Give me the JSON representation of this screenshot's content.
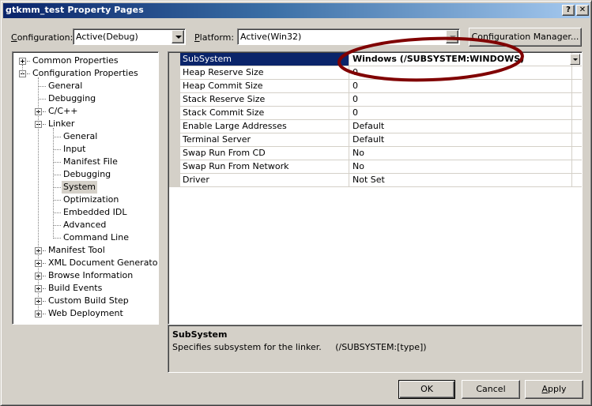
{
  "window": {
    "title": "gtkmm_test Property Pages",
    "help_button": "?",
    "close_button": "✕"
  },
  "toolbar": {
    "configuration_label_prefix": "C",
    "configuration_label_rest": "onfiguration:",
    "configuration_value": "Active(Debug)",
    "platform_label_prefix": "P",
    "platform_label_rest": "latform:",
    "platform_value": "Active(Win32)",
    "config_manager_label": "Configuration Manager..."
  },
  "tree": {
    "items": [
      {
        "label": "Common Properties",
        "level": 0,
        "expander": "plus"
      },
      {
        "label": "Configuration Properties",
        "level": 0,
        "expander": "minus"
      },
      {
        "label": "General",
        "level": 1
      },
      {
        "label": "Debugging",
        "level": 1
      },
      {
        "label": "C/C++",
        "level": 1,
        "expander": "plus"
      },
      {
        "label": "Linker",
        "level": 1,
        "expander": "minus"
      },
      {
        "label": "General",
        "level": 2
      },
      {
        "label": "Input",
        "level": 2
      },
      {
        "label": "Manifest File",
        "level": 2
      },
      {
        "label": "Debugging",
        "level": 2
      },
      {
        "label": "System",
        "level": 2,
        "selected": true
      },
      {
        "label": "Optimization",
        "level": 2
      },
      {
        "label": "Embedded IDL",
        "level": 2
      },
      {
        "label": "Advanced",
        "level": 2
      },
      {
        "label": "Command Line",
        "level": 2
      },
      {
        "label": "Manifest Tool",
        "level": 1,
        "expander": "plus"
      },
      {
        "label": "XML Document Generator",
        "level": 1,
        "expander": "plus"
      },
      {
        "label": "Browse Information",
        "level": 1,
        "expander": "plus"
      },
      {
        "label": "Build Events",
        "level": 1,
        "expander": "plus"
      },
      {
        "label": "Custom Build Step",
        "level": 1,
        "expander": "plus"
      },
      {
        "label": "Web Deployment",
        "level": 1,
        "expander": "plus"
      }
    ]
  },
  "grid": {
    "rows": [
      {
        "name": "SubSystem",
        "value": "Windows (/SUBSYSTEM:WINDOWS)",
        "selected": true
      },
      {
        "name": "Heap Reserve Size",
        "value": "0"
      },
      {
        "name": "Heap Commit Size",
        "value": "0"
      },
      {
        "name": "Stack Reserve Size",
        "value": "0"
      },
      {
        "name": "Stack Commit Size",
        "value": "0"
      },
      {
        "name": "Enable Large Addresses",
        "value": "Default"
      },
      {
        "name": "Terminal Server",
        "value": "Default"
      },
      {
        "name": "Swap Run From CD",
        "value": "No"
      },
      {
        "name": "Swap Run From Network",
        "value": "No"
      },
      {
        "name": "Driver",
        "value": "Not Set"
      }
    ]
  },
  "description": {
    "title": "SubSystem",
    "text": "Specifies subsystem for the linker.     (/SUBSYSTEM:[type])"
  },
  "buttons": {
    "ok": "OK",
    "cancel": "Cancel",
    "apply_prefix": "A",
    "apply_rest": "pply"
  },
  "colors": {
    "annotation_ellipse": "#800000",
    "selection": "#0a246a",
    "face": "#d4d0c8"
  }
}
